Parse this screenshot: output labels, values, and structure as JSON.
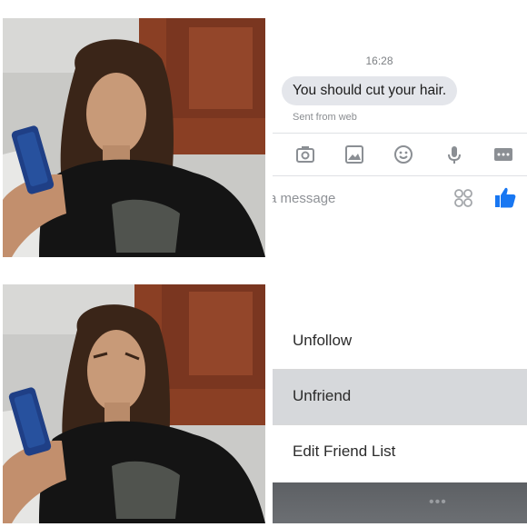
{
  "chat": {
    "timestamp": "16:28",
    "message": "You should cut your hair.",
    "sent_from": "Sent from web",
    "composer_placeholder": "a message"
  },
  "toolbar": {
    "icons": [
      "camera-icon",
      "image-icon",
      "emoji-icon",
      "microphone-icon",
      "more-icon"
    ]
  },
  "menu": {
    "items": [
      {
        "label": "Unfollow"
      },
      {
        "label": "Unfriend",
        "highlighted": true
      },
      {
        "label": "Edit Friend List"
      }
    ]
  },
  "colors": {
    "accent": "#1877f2",
    "bubble": "#e4e6eb",
    "highlight": "#d6d8db",
    "cabinet": "#8a3f24",
    "shirt": "#141414",
    "phone": "#1f3f86"
  }
}
